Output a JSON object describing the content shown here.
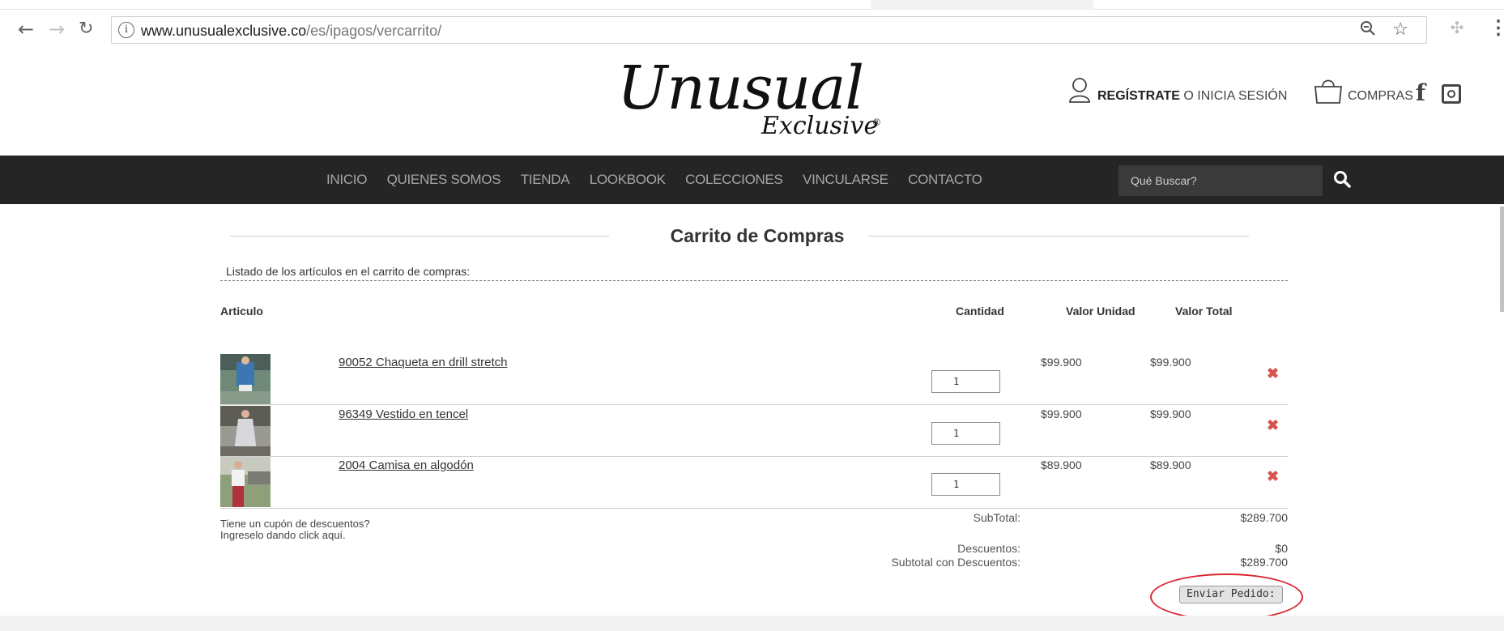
{
  "browser": {
    "url_domain": "www.unusualexclusive.co",
    "url_path": "/es/ipagos/vercarrito/",
    "info_icon": "info-icon",
    "zoom_icon": "zoom-icon",
    "star_icon": "star-icon"
  },
  "header": {
    "logo_main": "Unusual",
    "logo_sub": "Exclusive",
    "logo_reg": "®",
    "register_label": "REGÍSTRATE",
    "login_label": " O INICIA SESIÓN",
    "cart_label": "COMPRAS",
    "facebook_glyph": "f"
  },
  "nav": {
    "items": [
      "INICIO",
      "QUIENES SOMOS",
      "TIENDA",
      "LOOKBOOK",
      "COLECCIONES",
      "VINCULARSE",
      "CONTACTO"
    ],
    "search_placeholder": "Qué Buscar?"
  },
  "cart": {
    "title": "Carrito de Compras",
    "subtitle": "Listado de los artículos en el carrito de compras:",
    "columns": {
      "article": "Articulo",
      "quantity": "Cantidad",
      "unit_value": "Valor Unidad",
      "total_value": "Valor Total"
    },
    "items": [
      {
        "name": "90052 Chaqueta en drill stretch",
        "qty": "1",
        "unit": "$99.900",
        "total": "$99.900"
      },
      {
        "name": "96349 Vestido en tencel",
        "qty": "1",
        "unit": "$99.900",
        "total": "$99.900"
      },
      {
        "name": "2004 Camisa en algodón",
        "qty": "1",
        "unit": "$89.900",
        "total": "$89.900"
      }
    ],
    "coupon_line1": "Tiene un cupón de descuentos?",
    "coupon_line2": "Ingreselo dando click aquí.",
    "subtotal_label": "SubTotal:",
    "subtotal_value": "$289.700",
    "discount_label": "Descuentos:",
    "discount_value": "$0",
    "subtotal_discount_label": "Subtotal con Descuentos:",
    "subtotal_discount_value": "$289.700",
    "send_button": "Enviar Pedido:",
    "remove_icon": "✖"
  },
  "colors": {
    "navbar_bg": "#252525",
    "remove_red": "#d9534f",
    "highlight_circle": "#d9262e"
  }
}
